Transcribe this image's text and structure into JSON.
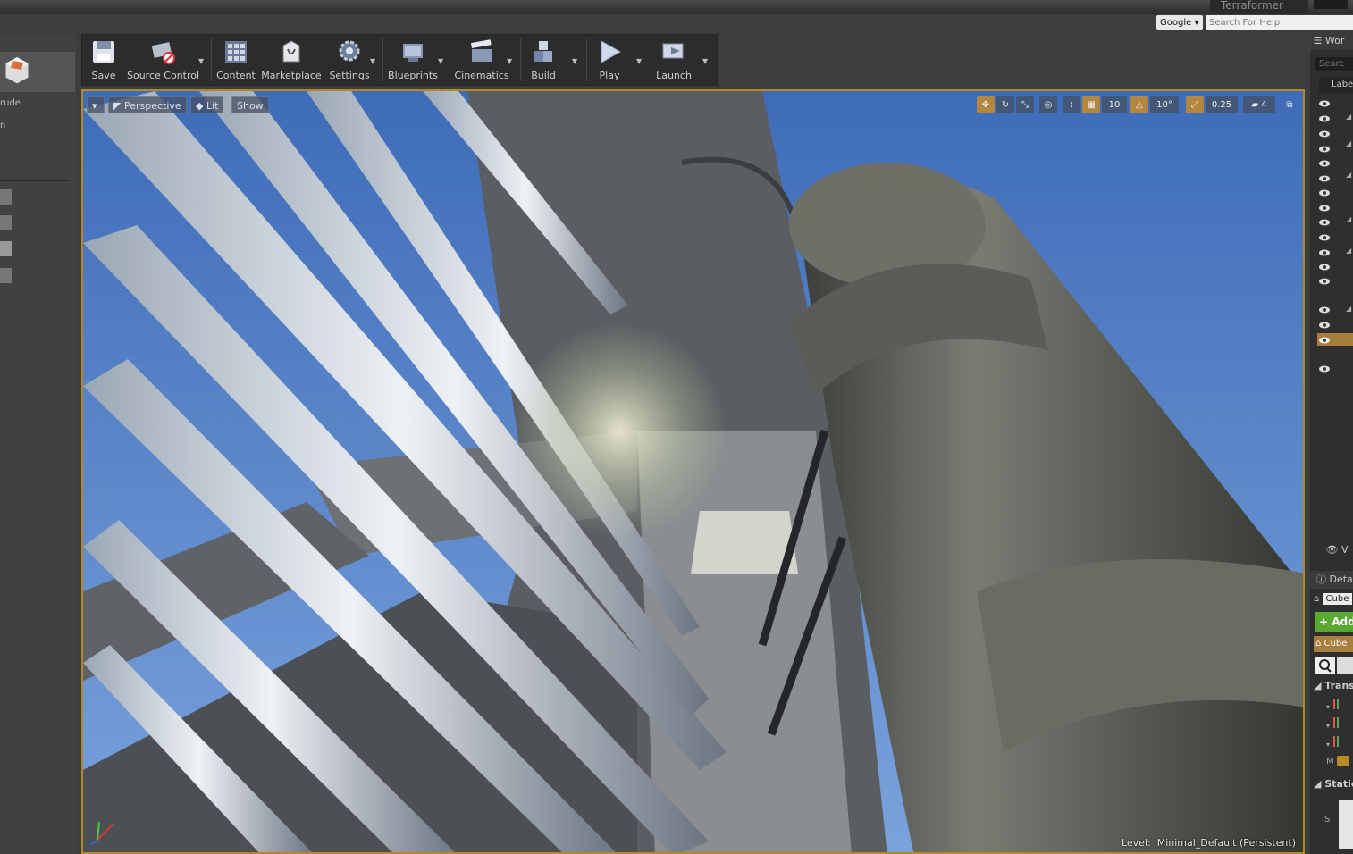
{
  "window": {
    "title": "Terraformer"
  },
  "help": {
    "google_label": "Google",
    "search_placeholder": "Search For Help"
  },
  "left_panel": {
    "items": [
      "rude",
      "n"
    ]
  },
  "toolbar": {
    "buttons": [
      {
        "label": "Save",
        "icon": "save-icon"
      },
      {
        "label": "Source Control",
        "icon": "source-control-icon"
      },
      {
        "label": "Content",
        "icon": "content-icon"
      },
      {
        "label": "Marketplace",
        "icon": "marketplace-icon"
      },
      {
        "label": "Settings",
        "icon": "settings-icon"
      },
      {
        "label": "Blueprints",
        "icon": "blueprints-icon"
      },
      {
        "label": "Cinematics",
        "icon": "cinematics-icon"
      },
      {
        "label": "Build",
        "icon": "build-icon"
      },
      {
        "label": "Play",
        "icon": "play-icon"
      },
      {
        "label": "Launch",
        "icon": "launch-icon"
      }
    ]
  },
  "viewport": {
    "perspective_label": "Perspective",
    "lit_label": "Lit",
    "show_label": "Show",
    "grid_snap": "10",
    "rotation_snap": "10°",
    "scale_snap": "0.25",
    "camera_speed": "4",
    "level_prefix": "Level:",
    "level_name": "Minimal_Default (Persistent)"
  },
  "outliner": {
    "header": "Wor",
    "search_placeholder": "Searc",
    "column": "Labe",
    "footer": "V"
  },
  "details": {
    "header": "Deta",
    "actor_name": "Cube",
    "add_label": "+ Add",
    "component": "Cube",
    "section_transform": "Transf",
    "transform_row_m": "M",
    "section_static": "Static",
    "static_row_s": "S"
  },
  "colors": {
    "viewport_border": "#b08a2a",
    "add_button": "#5aa832",
    "selected_row": "#a87e3d"
  }
}
